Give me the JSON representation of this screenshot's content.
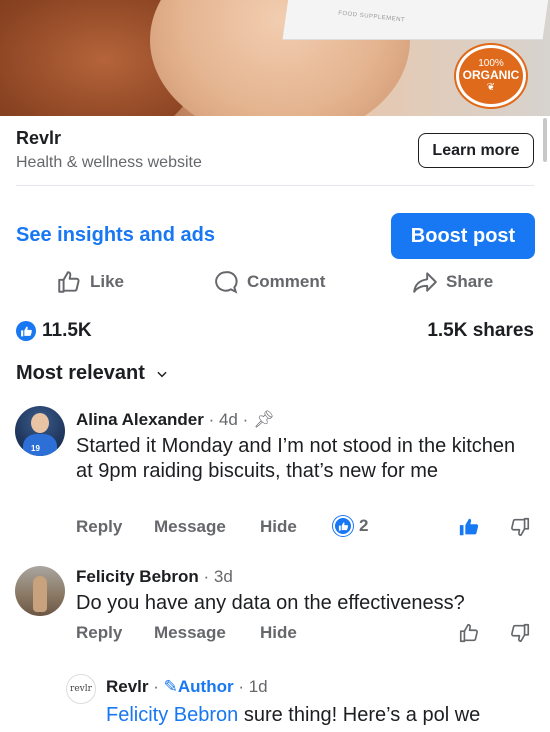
{
  "hero": {
    "box_text": "FOOD SUPPLEMENT",
    "badge_line1": "100%",
    "badge_line2": "ORGANIC"
  },
  "advertiser": {
    "name": "Revlr",
    "category": "Health & wellness website",
    "cta": "Learn more"
  },
  "links": {
    "insights": "See insights and ads",
    "boost": "Boost post"
  },
  "actions": {
    "like": "Like",
    "comment": "Comment",
    "share": "Share"
  },
  "stats": {
    "reactions": "11.5K",
    "shares": "1.5K shares"
  },
  "sort": {
    "label": "Most relevant"
  },
  "comments": [
    {
      "name": "Alina Alexander",
      "meta": " · 4d · ",
      "text": "Started it Monday and I’m not stood in the kitchen at 9pm raiding biscuits, that’s new for me",
      "reply": "Reply",
      "message": "Message",
      "hide": "Hide",
      "likes": "2",
      "avatar_number": "19"
    },
    {
      "name": "Felicity Bebron",
      "meta": " · 3d",
      "text": "Do you have any data on the effectiveness?",
      "reply": "Reply",
      "message": "Message",
      "hide": "Hide"
    },
    {
      "name": "Revlr",
      "meta_sep": " · ",
      "author_badge": "Author",
      "meta": " · 1d",
      "avatar_text": "revlr",
      "mention": "Felicity Bebron",
      "text": " sure thing! Here’s a pol we"
    }
  ],
  "colors": {
    "accent": "#1877f2",
    "text": "#1c1e21",
    "muted": "#65676b",
    "badge": "#e06a1b"
  }
}
